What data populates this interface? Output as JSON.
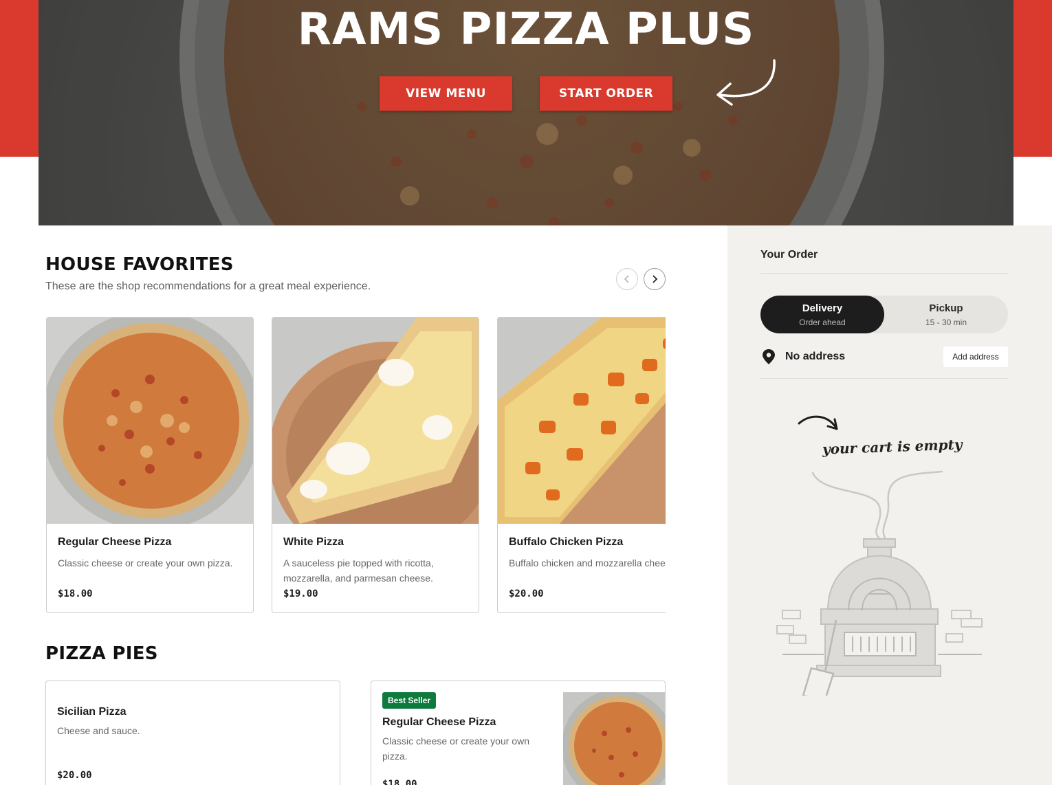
{
  "hero": {
    "title": "RAMS PIZZA PLUS",
    "view_menu_label": "VIEW MENU",
    "start_order_label": "START ORDER"
  },
  "house_favorites": {
    "title": "HOUSE FAVORITES",
    "subtitle": "These are the shop recommendations for a great meal experience.",
    "items": [
      {
        "name": "Regular Cheese Pizza",
        "description": "Classic cheese or create your own pizza.",
        "price": "$18.00"
      },
      {
        "name": "White Pizza",
        "description": "A sauceless pie topped with ricotta, mozzarella, and parmesan cheese.",
        "price": "$19.00"
      },
      {
        "name": "Buffalo Chicken Pizza",
        "description": "Buffalo chicken and mozzarella cheese.",
        "price": "$20.00"
      }
    ]
  },
  "pizza_pies": {
    "title": "PIZZA PIES",
    "items": [
      {
        "name": "Sicilian Pizza",
        "description": "Cheese and sauce.",
        "price": "$20.00"
      },
      {
        "badge": "Best Seller",
        "name": "Regular Cheese Pizza",
        "description": "Classic cheese or create your own pizza.",
        "price": "$18.00"
      }
    ]
  },
  "order": {
    "title": "Your Order",
    "delivery_label": "Delivery",
    "delivery_sub": "Order ahead",
    "pickup_label": "Pickup",
    "pickup_sub": "15 - 30 min",
    "address_text": "No address",
    "add_address_label": "Add address",
    "empty_text": "your cart is empty"
  },
  "colors": {
    "brand_red": "#d93a2d",
    "badge_green": "#0e7a3d",
    "sidebar_bg": "#f2f1ee",
    "toggle_active": "#1d1d1d"
  },
  "icons": [
    "arrow-icon",
    "chevron-left-icon",
    "chevron-right-icon",
    "location-pin-icon",
    "pizza-oven-illustration"
  ]
}
